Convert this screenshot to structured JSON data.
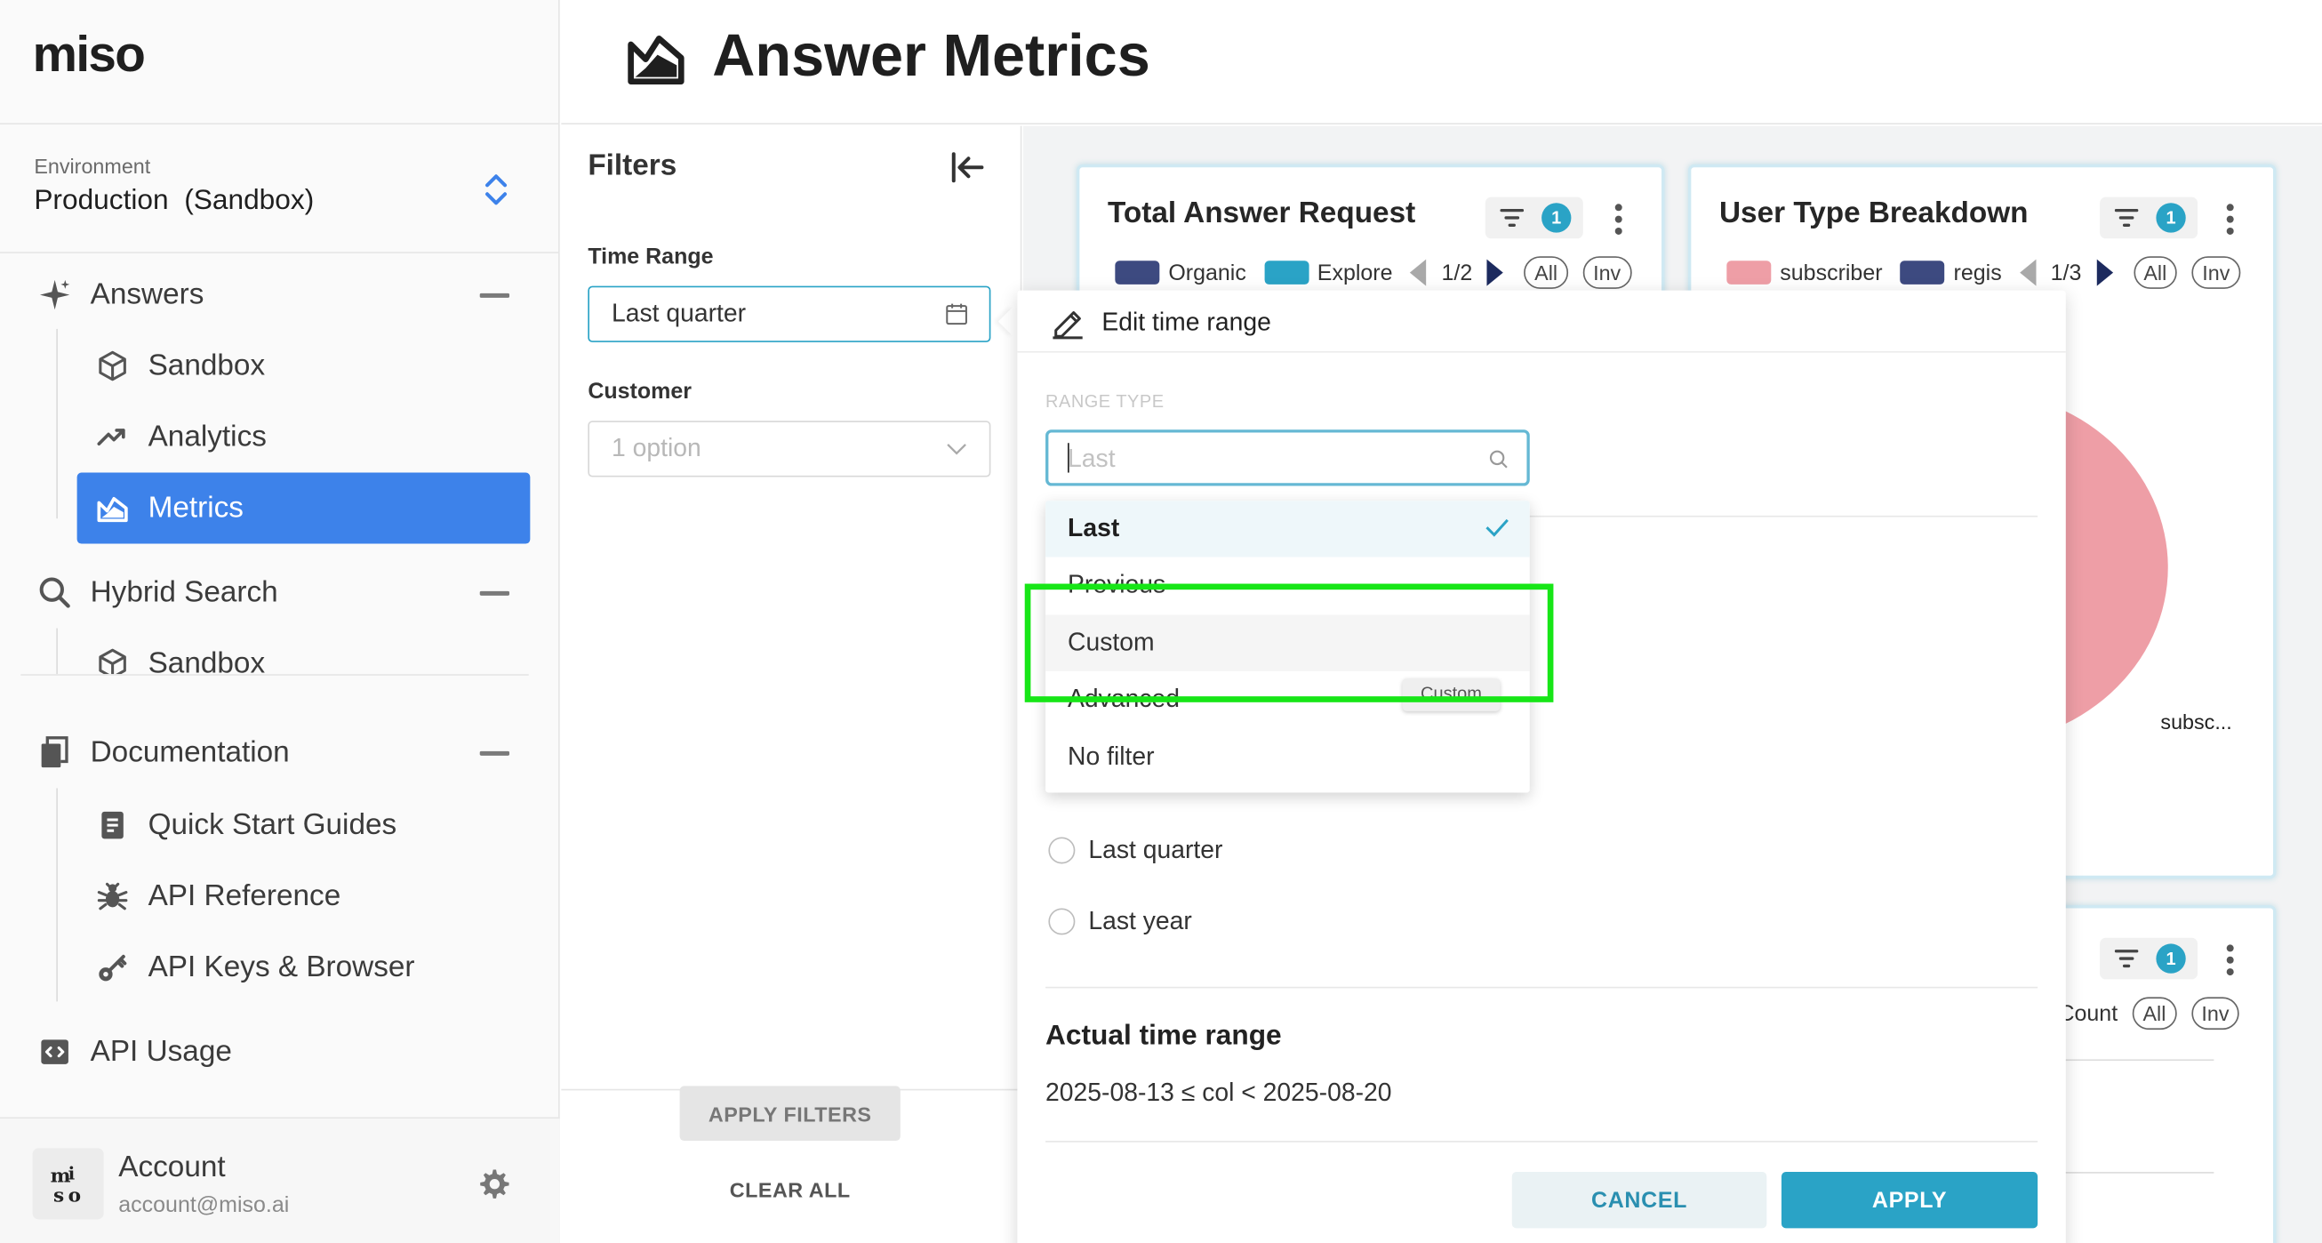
{
  "brand": {
    "logo_text": "miso"
  },
  "environment": {
    "label": "Environment",
    "value": "Production  (Sandbox)"
  },
  "nav": {
    "answers": {
      "label": "Answers",
      "items": [
        {
          "label": "Sandbox",
          "icon": "cube-icon"
        },
        {
          "label": "Analytics",
          "icon": "trend-icon"
        },
        {
          "label": "Metrics",
          "icon": "chart-area-icon",
          "active": true
        }
      ]
    },
    "hybrid_search": {
      "label": "Hybrid Search",
      "items": [
        {
          "label": "Sandbox",
          "icon": "cube-icon"
        }
      ]
    },
    "documentation": {
      "label": "Documentation",
      "items": [
        {
          "label": "Quick Start Guides",
          "icon": "document-icon"
        },
        {
          "label": "API Reference",
          "icon": "bug-icon"
        },
        {
          "label": "API Keys & Browser",
          "icon": "key-icon"
        }
      ]
    },
    "api_usage": {
      "label": "API Usage"
    }
  },
  "account": {
    "avatar_text": "ᵐi\nso",
    "name": "Account",
    "email": "account@miso.ai"
  },
  "header": {
    "title": "Answer Metrics"
  },
  "filters": {
    "title": "Filters",
    "time_range_label": "Time Range",
    "time_range_value": "Last quarter",
    "customer_label": "Customer",
    "customer_placeholder": "1 option",
    "apply_label": "APPLY FILTERS",
    "clear_label": "CLEAR ALL"
  },
  "cards": {
    "total": {
      "title": "Total Answer Request",
      "filter_count": "1",
      "legend": [
        {
          "label": "Organic",
          "color": "#3d4a80"
        },
        {
          "label": "Explore",
          "color": "#2aa3c6"
        }
      ],
      "page": "1/2",
      "all": "All",
      "inv": "Inv"
    },
    "user_type": {
      "title": "User Type Breakdown",
      "filter_count": "1",
      "legend": [
        {
          "label": "subscriber",
          "color": "#ee9ea6"
        },
        {
          "label": "regis",
          "color": "#3d4a80"
        }
      ],
      "page": "1/3",
      "all": "All",
      "inv": "Inv",
      "slice_label": "subsc...",
      "slice_color": "#ee9ea6"
    },
    "third": {
      "filter_count": "1",
      "legend_fragment": "Count",
      "all": "All",
      "inv": "Inv"
    }
  },
  "popover": {
    "title": "Edit time range",
    "range_type_label": "RANGE TYPE",
    "search_placeholder": "Last",
    "options": [
      "Last",
      "Previous",
      "Custom",
      "Advanced",
      "No filter"
    ],
    "selected_option": "Last",
    "hovered_option": "Custom",
    "tooltip": "Custom",
    "radios": [
      "Last quarter",
      "Last year"
    ],
    "actual_title": "Actual time range",
    "actual_value": "2025-08-13 ≤ col < 2025-08-20",
    "cancel": "CANCEL",
    "apply": "APPLY"
  },
  "colors": {
    "accent": "#2aa3c6",
    "nav_active": "#3d82ea",
    "highlight": "#17e617"
  }
}
